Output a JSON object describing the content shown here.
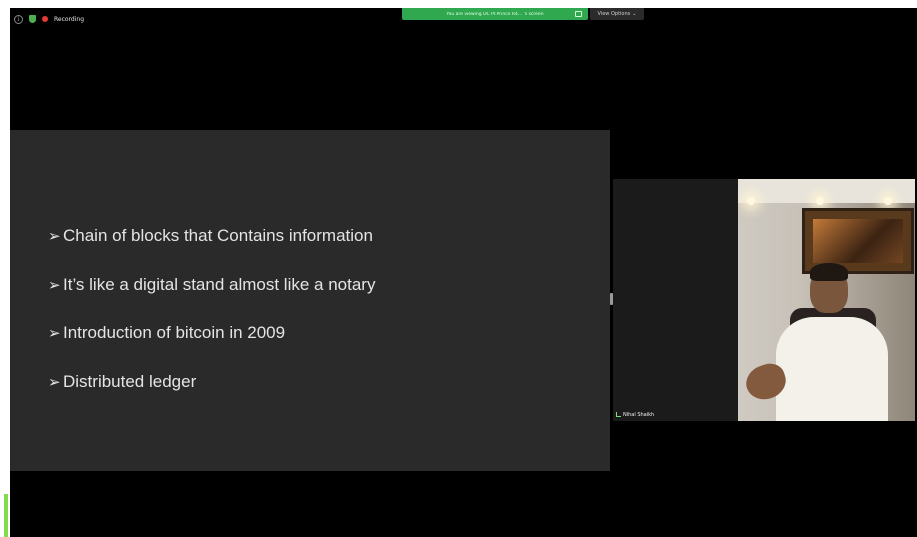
{
  "status_bar": {
    "recording_label": "Recording",
    "share_banner_text": "You are viewing DC Pr.Prince R4... 's screen",
    "view_options_label": "View Options",
    "view_options_icon": "chevron-down-icon"
  },
  "slide": {
    "items": [
      {
        "text": "Chain of blocks that Contains information"
      },
      {
        "text": "It’s like a digital stand almost like a notary"
      },
      {
        "text": "Introduction of bitcoin in 2009"
      },
      {
        "text": "Distributed ledger"
      }
    ],
    "bullet_glyph": "➢"
  },
  "participant": {
    "name": "Nihal Shaikh"
  },
  "colors": {
    "recording_red": "#e53935",
    "share_green": "#2fa84f",
    "slide_bg": "#2a2a2b"
  }
}
